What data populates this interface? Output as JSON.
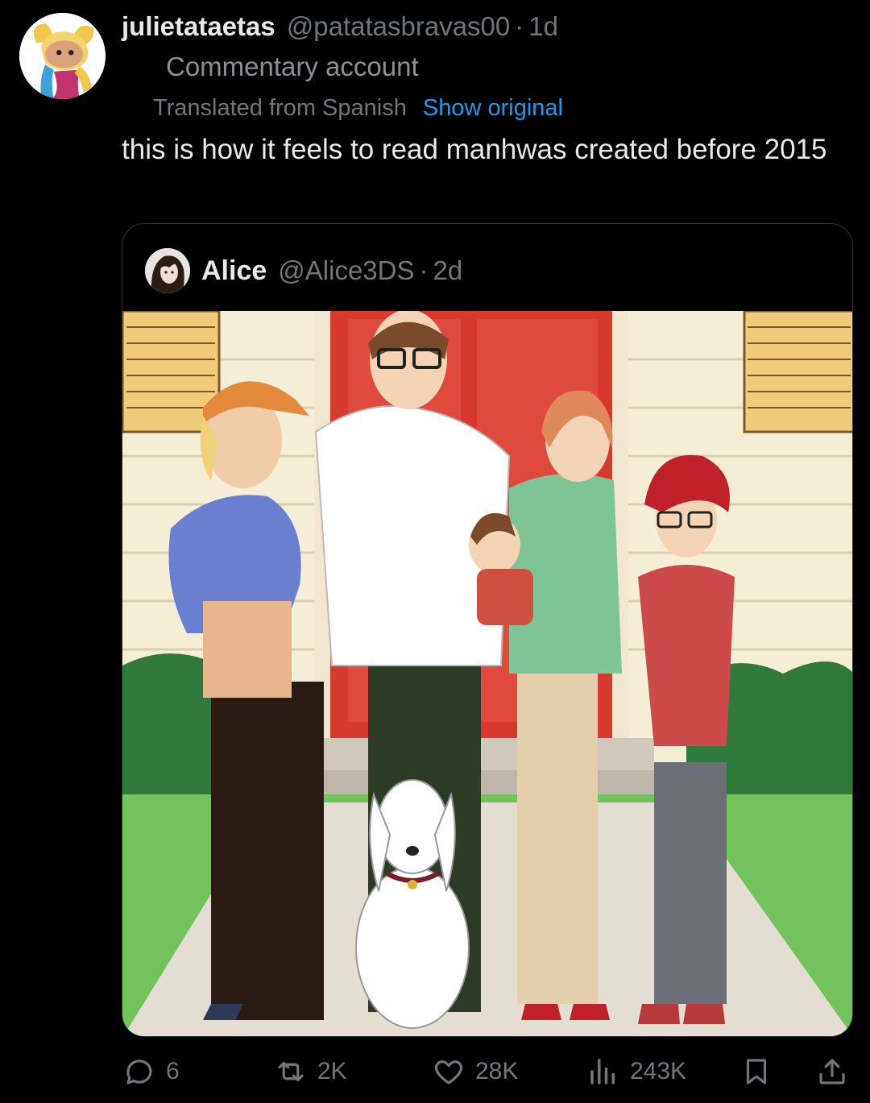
{
  "post": {
    "display_name": "julietataetas",
    "handle": "@patatasbravas00",
    "separator": "·",
    "time": "1d",
    "label": "Commentary account",
    "translated_text": "Translated from Spanish",
    "show_original": "Show original",
    "text": "this is how it feels to read manhwas created before 2015",
    "avatar_icon": "cartoon-mouse-avatar"
  },
  "quote": {
    "display_name": "Alice",
    "handle": "@Alice3DS",
    "separator": "·",
    "time": "2d",
    "avatar_icon": "illustrated-portrait-avatar",
    "image_description_icon": "illustrated-family-in-front-of-house"
  },
  "actions": {
    "reply": {
      "icon": "reply-icon",
      "count": "6"
    },
    "repost": {
      "icon": "repost-icon",
      "count": "2K"
    },
    "like": {
      "icon": "heart-icon",
      "count": "28K"
    },
    "views": {
      "icon": "views-bar-chart-icon",
      "count": "243K"
    },
    "bookmark": {
      "icon": "bookmark-icon"
    },
    "share": {
      "icon": "share-icon"
    }
  },
  "colors": {
    "background": "#000000",
    "text_primary": "#e7e9ea",
    "text_secondary": "#71767b",
    "link": "#1d9bf0",
    "border": "#2f3336"
  }
}
